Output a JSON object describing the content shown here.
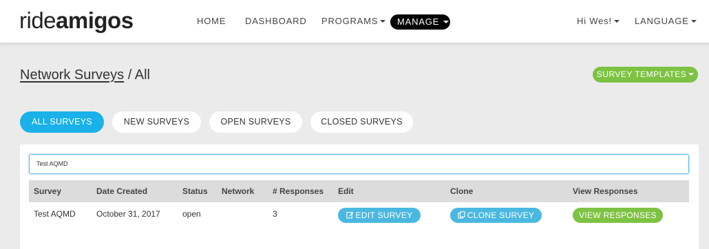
{
  "header": {
    "logo_light": "ride",
    "logo_bold": "amigos",
    "nav": {
      "home": "HOME",
      "dashboard": "DASHBOARD",
      "programs": "PROGRAMS",
      "manage": "MANAGE",
      "greeting": "Hi Wes!",
      "language": "LANGUAGE"
    }
  },
  "page": {
    "breadcrumb": "Network Surveys",
    "separator": " / ",
    "current": "All",
    "templates_button": "SURVEY TEMPLATES"
  },
  "filters": [
    {
      "label": "ALL SURVEYS",
      "active": true
    },
    {
      "label": "NEW SURVEYS",
      "active": false
    },
    {
      "label": "OPEN SURVEYS",
      "active": false
    },
    {
      "label": "CLOSED SURVEYS",
      "active": false
    }
  ],
  "search": {
    "value": "Test AQMD"
  },
  "table": {
    "headers": [
      "Survey",
      "Date Created",
      "Status",
      "Network",
      "# Responses",
      "Edit",
      "Clone",
      "View Responses"
    ],
    "rows": [
      {
        "survey": "Test AQMD",
        "date": "October 31, 2017",
        "status": "open",
        "network": "",
        "responses": "3",
        "edit_label": "EDIT SURVEY",
        "clone_label": "CLONE SURVEY",
        "view_label": "VIEW RESPONSES"
      }
    ]
  },
  "colors": {
    "accent_blue": "#19b1e8",
    "action_blue": "#4ab8e0",
    "accent_green": "#7dc242",
    "manage_black": "#000000"
  },
  "icons": {
    "edit": "edit-icon",
    "clone": "clone-icon",
    "caret": "caret-down-icon"
  }
}
